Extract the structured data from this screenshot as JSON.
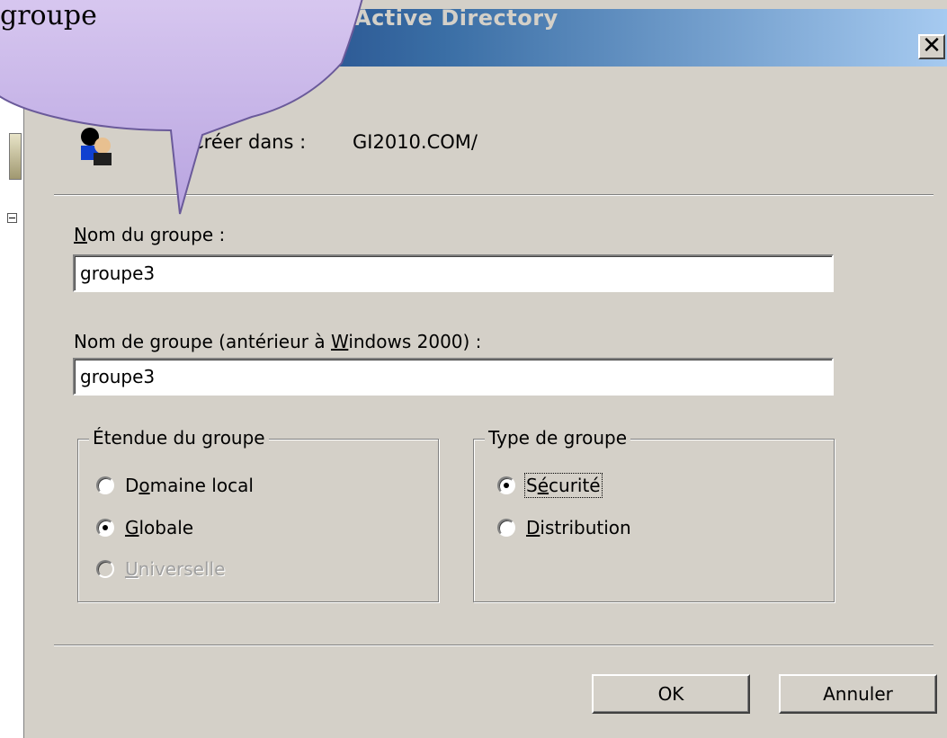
{
  "window": {
    "title": "Active Directory"
  },
  "callout": {
    "text": "groupe"
  },
  "create_in": {
    "label": "Créer dans :",
    "path": "GI2010.COM/"
  },
  "fields": {
    "group_name": {
      "label_access": "N",
      "label_rest": "om du groupe :",
      "value": "groupe3"
    },
    "group_name_pre2000": {
      "label_before": "Nom de groupe (antérieur à ",
      "label_access": "W",
      "label_after": "indows 2000) :",
      "value": "groupe3"
    }
  },
  "scope": {
    "title": "Étendue du groupe",
    "options": [
      {
        "pre": "D",
        "access": "o",
        "post": "maine local",
        "checked": false,
        "enabled": true
      },
      {
        "pre": "",
        "access": "G",
        "post": "lobale",
        "checked": true,
        "enabled": true
      },
      {
        "pre": "",
        "access": "U",
        "post": "niverselle",
        "checked": false,
        "enabled": false
      }
    ]
  },
  "type": {
    "title": "Type de groupe",
    "options": [
      {
        "pre": "S",
        "access": "é",
        "post": "curité",
        "checked": true
      },
      {
        "pre": "",
        "access": "D",
        "post": "istribution",
        "checked": false
      }
    ]
  },
  "buttons": {
    "ok": "OK",
    "cancel": "Annuler"
  }
}
